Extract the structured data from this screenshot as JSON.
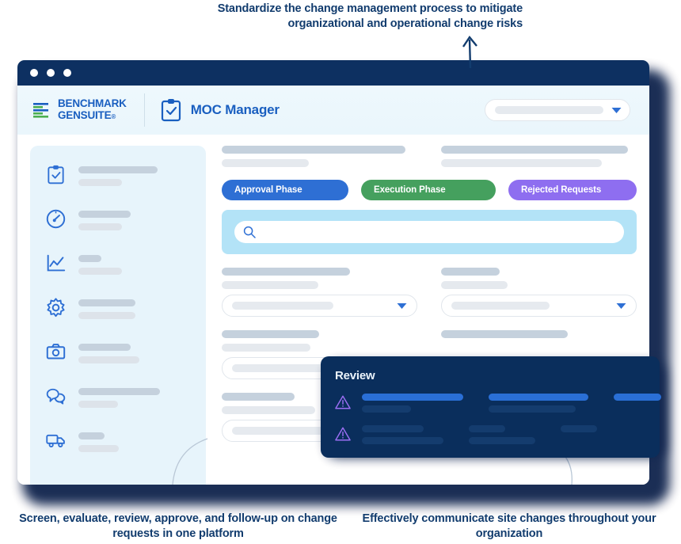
{
  "callouts": {
    "top": "Standardize the change management process to mitigate organizational and operational change risks",
    "bottom_left": "Screen, evaluate, review, approve, and follow-up on change requests in one platform",
    "bottom_right": "Effectively communicate site changes throughout your organization"
  },
  "window": {
    "title_bar": {
      "dots": [
        "close-dot",
        "minimize-dot",
        "maximize-dot"
      ]
    }
  },
  "header": {
    "brand_line1": "BENCHMARK",
    "brand_line2": "GENSUITE",
    "brand_registered": "®",
    "brand_mark_icon": "benchmark-bars-logo",
    "module_icon": "clipboard-check-icon",
    "module_title": "MOC Manager",
    "dropdown": {
      "icon": "chevron-down-icon",
      "value": ""
    }
  },
  "sidebar": {
    "items": [
      {
        "icon": "clipboard-check-icon",
        "label": "",
        "bar1_width": 100,
        "bar2_width": 55
      },
      {
        "icon": "gauge-icon",
        "label": "",
        "bar1_width": 66,
        "bar2_width": 55
      },
      {
        "icon": "line-chart-icon",
        "label": "",
        "bar1_width": 29,
        "bar2_width": 55
      },
      {
        "icon": "gear-icon",
        "label": "",
        "bar1_width": 72,
        "bar2_width": 72
      },
      {
        "icon": "camera-icon",
        "label": "",
        "bar1_width": 66,
        "bar2_width": 77
      },
      {
        "icon": "chat-bubbles-icon",
        "label": "",
        "bar1_width": 103,
        "bar2_width": 50
      },
      {
        "icon": "truck-icon",
        "label": "",
        "bar1_width": 33,
        "bar2_width": 51
      }
    ]
  },
  "main": {
    "top_placeholders": {
      "left": {
        "title_width": 232,
        "sub_width": 110
      },
      "right": {
        "title_width": 236,
        "sub_width": 203
      }
    },
    "tabs": [
      {
        "label": "Approval Phase",
        "color": "#2e6fd4"
      },
      {
        "label": "Execution Phase",
        "color": "#45a05e"
      },
      {
        "label": "Rejected Requests",
        "color": "#8e6ef0"
      }
    ],
    "search": {
      "icon": "search-icon",
      "placeholder": "",
      "value": ""
    },
    "fields": [
      {
        "label_width": 162,
        "sub_width": 122,
        "select": {
          "icon": "chevron-down-icon",
          "value": "",
          "ghost_width": 128
        }
      },
      {
        "label_width": 74,
        "sub_width": 84,
        "select": {
          "icon": "chevron-down-icon",
          "value": "",
          "ghost_width": 124
        }
      }
    ],
    "fields_lower": [
      {
        "label_width": 123,
        "sub_width": 112,
        "select": {
          "icon": "chevron-down-icon",
          "value": "",
          "ghost_width": 128
        }
      },
      {
        "label_width": 160,
        "sub_width": 0,
        "select": {
          "icon": "",
          "value": "",
          "ghost_width": 0
        }
      }
    ],
    "fields_bottom": {
      "label_width": 92,
      "sub_width": 118,
      "select": {
        "icon": "chevron-down-icon",
        "value": "",
        "ghost_width": 125
      }
    }
  },
  "review_panel": {
    "title": "Review",
    "rows": [
      {
        "icon": "warning-triangle-icon",
        "cells": [
          {
            "bar1_width": 128,
            "bar1_style": "accent",
            "bar2_width": 62,
            "bar2_style": "muted"
          },
          {
            "bar1_width": 126,
            "bar1_style": "accent",
            "bar2_width": 110,
            "bar2_style": "muted"
          },
          {
            "bar1_width": 60,
            "bar1_style": "accent",
            "bar2_width": 0,
            "bar2_style": "muted"
          }
        ]
      },
      {
        "icon": "warning-triangle-icon",
        "cells": [
          {
            "bar1_width": 78,
            "bar1_style": "muted",
            "bar2_width": 103,
            "bar2_style": "muted"
          },
          {
            "bar1_width": 46,
            "bar1_style": "muted",
            "bar2_width": 84,
            "bar2_style": "muted"
          },
          {
            "bar1_width": 46,
            "bar1_style": "muted",
            "bar2_width": 0,
            "bar2_style": "muted"
          }
        ]
      }
    ]
  },
  "colors": {
    "navy_deep": "#0d3061",
    "navy_card": "#0a2e5c",
    "brand_blue": "#1a5fc0",
    "brand_green": "#4caf50",
    "accent_blue": "#2e6fd4",
    "accent_green": "#45a05e",
    "accent_purple": "#8e6ef0",
    "search_band": "#b3e3f7",
    "sidebar_bg": "#e7f4fb",
    "headline_text": "#123c6e"
  }
}
